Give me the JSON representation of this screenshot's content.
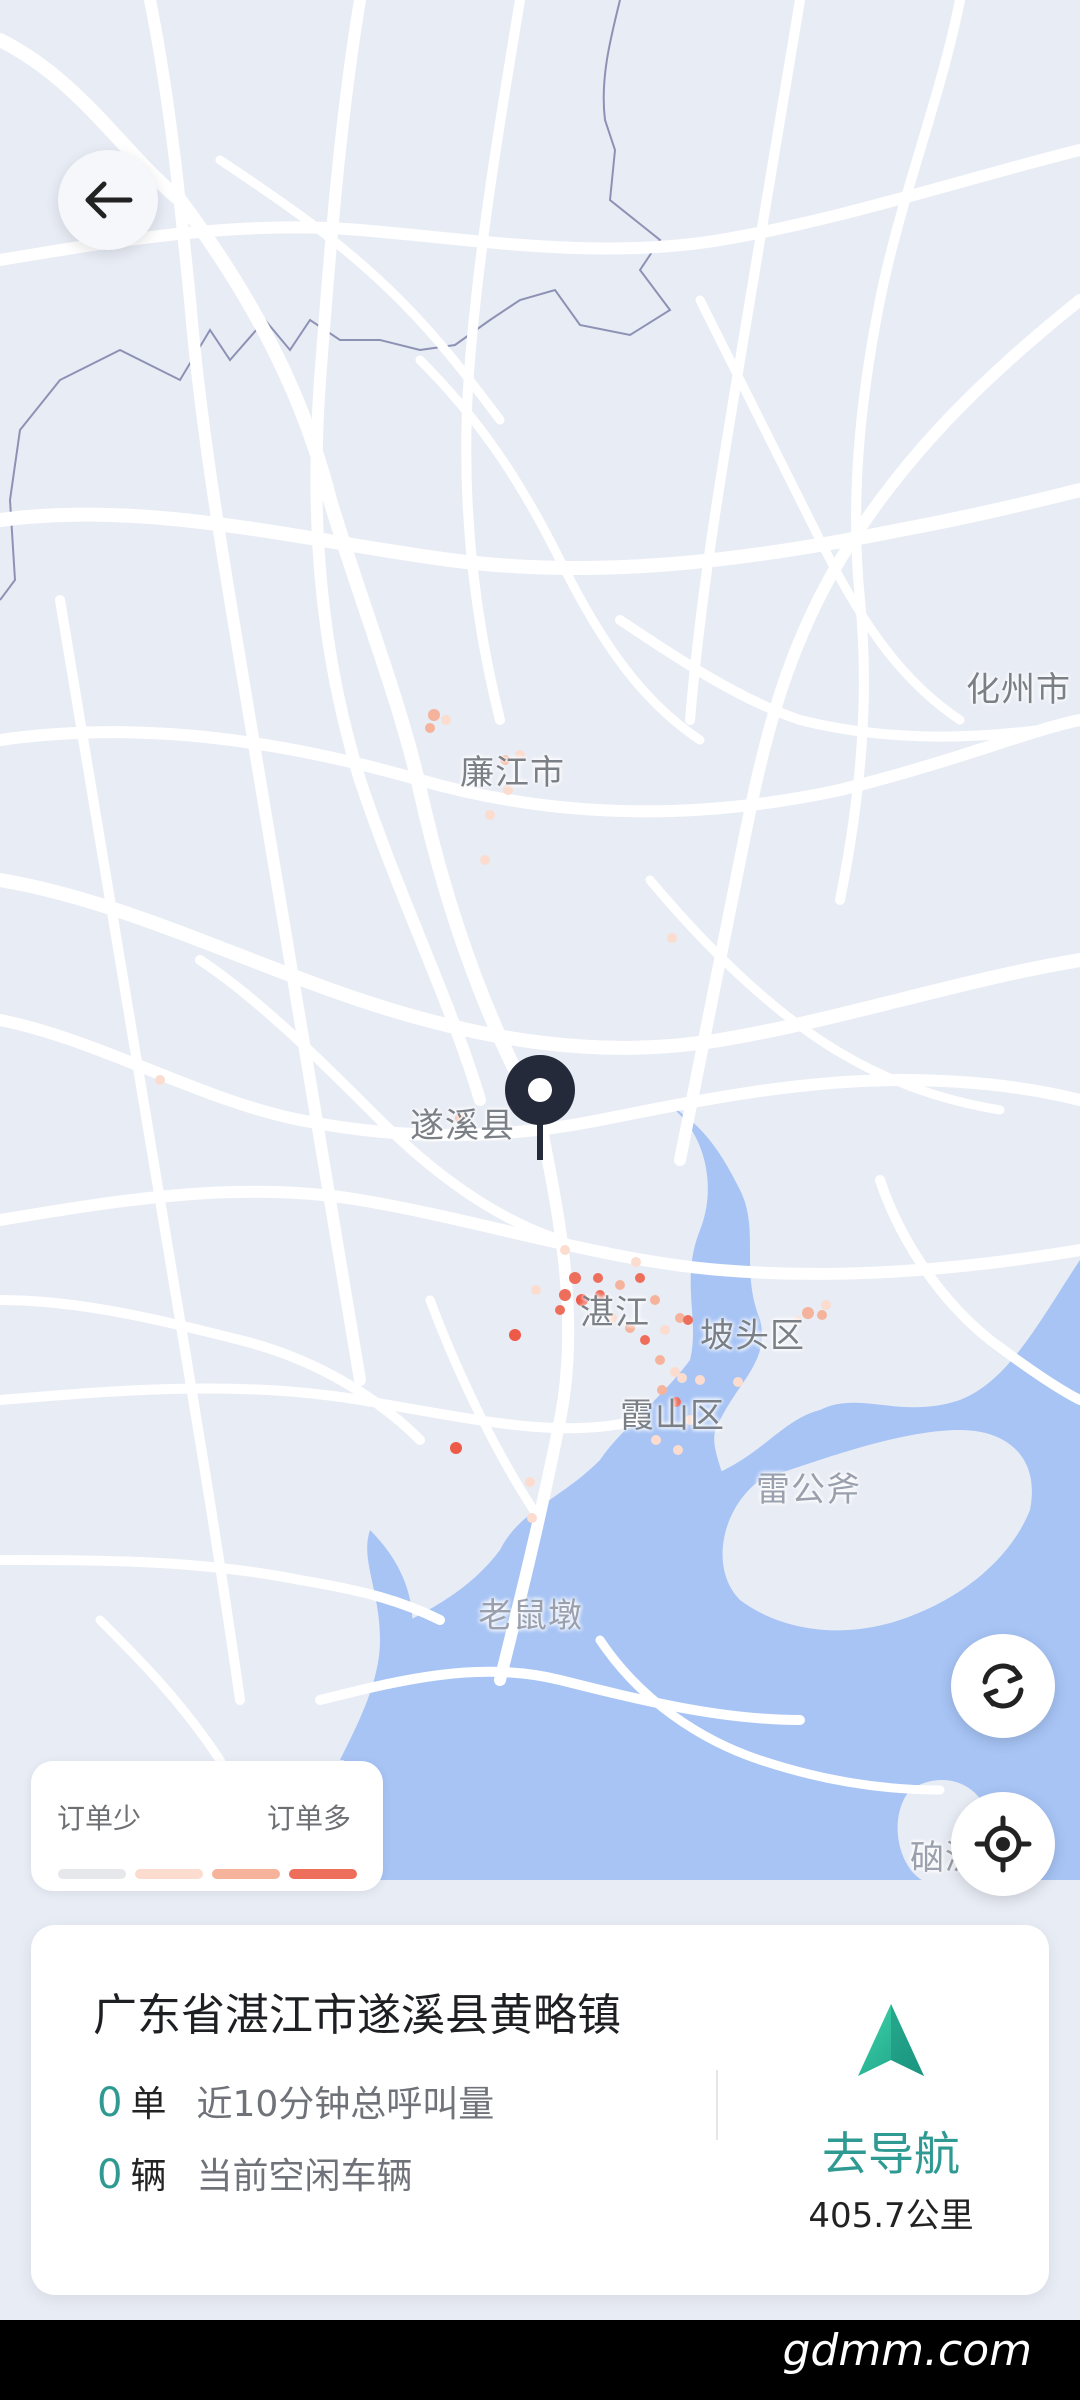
{
  "map": {
    "labels": {
      "huazhou": "化州市",
      "lianjiang": "廉江市",
      "suixi": "遂溪县",
      "zhanjiang": "湛江",
      "potou": "坡头区",
      "xiashan": "霞山区",
      "leigongfu": "雷公斧",
      "laoshudun": "老鼠墩",
      "naozhou": "硇洲"
    }
  },
  "legend": {
    "low_label": "订单少",
    "high_label": "订单多",
    "colors": [
      "#e6e7eb",
      "#fbdccf",
      "#f5b39c",
      "#ee6e5c"
    ]
  },
  "info_card": {
    "address": "广东省湛江市遂溪县黄略镇",
    "orders_count": "0",
    "orders_unit": "单",
    "orders_desc": "近10分钟总呼叫量",
    "cars_count": "0",
    "cars_unit": "辆",
    "cars_desc": "当前空闲车辆",
    "nav_label": "去导航",
    "nav_distance": "405.7公里"
  },
  "watermark": "gdmm.com",
  "colors": {
    "accent": "#2f9a92",
    "water": "#a7c4f5",
    "land": "#e8ecf5",
    "road": "#ffffff",
    "heat_high": "#ee5a48"
  },
  "icons": {
    "back": "arrow-left-icon",
    "refresh": "refresh-icon",
    "locate": "locate-icon",
    "pin": "location-pin-icon",
    "navigate": "navigation-arrow-icon"
  }
}
